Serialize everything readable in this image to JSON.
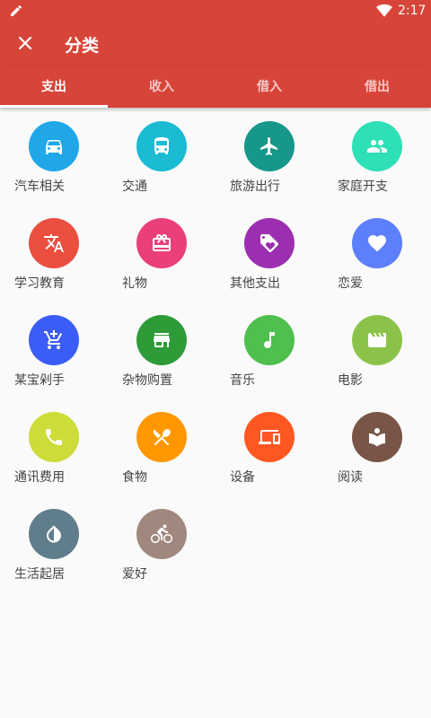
{
  "status_bar": {
    "time": "2:17"
  },
  "app_bar": {
    "title": "分类"
  },
  "tabs": [
    {
      "label": "支出",
      "active": true
    },
    {
      "label": "收入",
      "active": false
    },
    {
      "label": "借入",
      "active": false
    },
    {
      "label": "借出",
      "active": false
    }
  ],
  "categories": [
    {
      "label": "汽车相关",
      "color": "#1fa7e8",
      "icon": "car-icon"
    },
    {
      "label": "交通",
      "color": "#1bbbd4",
      "icon": "bus-icon"
    },
    {
      "label": "旅游出行",
      "color": "#16978a",
      "icon": "airplane-icon"
    },
    {
      "label": "家庭开支",
      "color": "#2ee0b6",
      "icon": "family-icon"
    },
    {
      "label": "学习教育",
      "color": "#ea4f3f",
      "icon": "translate-icon"
    },
    {
      "label": "礼物",
      "color": "#ea3f77",
      "icon": "gift-icon"
    },
    {
      "label": "其他支出",
      "color": "#9b2fb0",
      "icon": "tag-heart-icon"
    },
    {
      "label": "恋爱",
      "color": "#5d7ffb",
      "icon": "heart-icon"
    },
    {
      "label": "某宝剁手",
      "color": "#3b5cf7",
      "icon": "cart-add-icon"
    },
    {
      "label": "杂物购置",
      "color": "#2e9b38",
      "icon": "store-icon"
    },
    {
      "label": "音乐",
      "color": "#4fbf4d",
      "icon": "music-note-icon"
    },
    {
      "label": "电影",
      "color": "#8bc34a",
      "icon": "movie-icon"
    },
    {
      "label": "通讯费用",
      "color": "#cddc39",
      "icon": "phone-icon"
    },
    {
      "label": "食物",
      "color": "#ff9800",
      "icon": "fork-knife-icon"
    },
    {
      "label": "设备",
      "color": "#ff5722",
      "icon": "devices-icon"
    },
    {
      "label": "阅读",
      "color": "#795548",
      "icon": "book-icon"
    },
    {
      "label": "生活起居",
      "color": "#607d8b",
      "icon": "contrast-drop-icon"
    },
    {
      "label": "爱好",
      "color": "#a1887f",
      "icon": "bike-icon"
    }
  ]
}
